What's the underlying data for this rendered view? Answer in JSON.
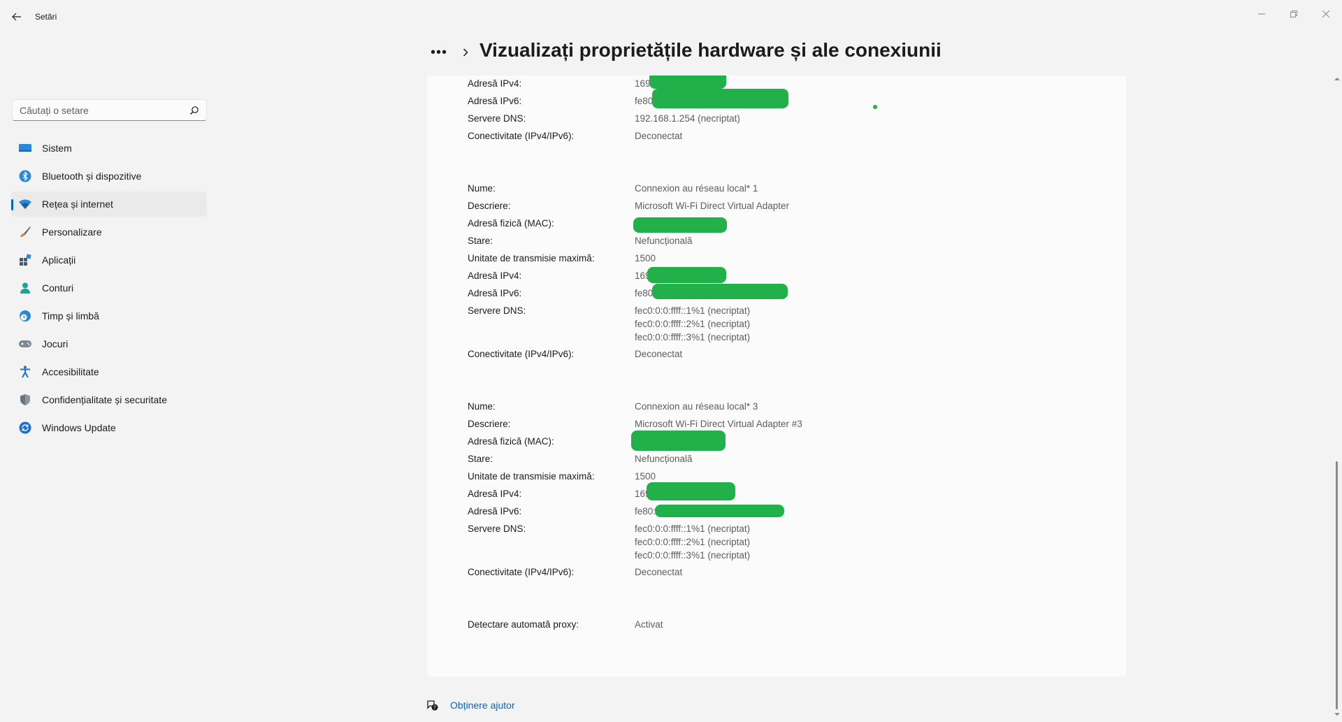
{
  "window": {
    "app_title": "Setări"
  },
  "search": {
    "placeholder": "Căutați o setare"
  },
  "sidebar": {
    "items": [
      {
        "label": "Sistem",
        "icon": "system-icon"
      },
      {
        "label": "Bluetooth și dispozitive",
        "icon": "bluetooth-icon"
      },
      {
        "label": "Rețea și internet",
        "icon": "wifi-icon",
        "active": true
      },
      {
        "label": "Personalizare",
        "icon": "brush-icon"
      },
      {
        "label": "Aplicații",
        "icon": "apps-icon"
      },
      {
        "label": "Conturi",
        "icon": "account-icon"
      },
      {
        "label": "Timp și limbă",
        "icon": "globe-clock-icon"
      },
      {
        "label": "Jocuri",
        "icon": "gamepad-icon"
      },
      {
        "label": "Accesibilitate",
        "icon": "accessibility-icon"
      },
      {
        "label": "Confidențialitate și securitate",
        "icon": "shield-icon"
      },
      {
        "label": "Windows Update",
        "icon": "update-icon"
      }
    ]
  },
  "header": {
    "more": "•••",
    "title": "Vizualizați proprietățile hardware și ale conexiunii"
  },
  "top_block": {
    "ipv4_label": "Adresă IPv4:",
    "ipv4_value": "169",
    "ipv6_label": "Adresă IPv6:",
    "ipv6_value": "fe80",
    "dns_label": "Servere DNS:",
    "dns_value": "192.168.1.254 (necriptat)",
    "conn_label": "Conectivitate (IPv4/IPv6):",
    "conn_value": "Deconectat"
  },
  "adapter1": {
    "name_label": "Nume:",
    "name_value": "Connexion au réseau local* 1",
    "desc_label": "Descriere:",
    "desc_value": "Microsoft Wi-Fi Direct Virtual Adapter",
    "mac_label": "Adresă fizică (MAC):",
    "state_label": "Stare:",
    "state_value": "Nefuncțională",
    "mtu_label": "Unitate de transmisie maximă:",
    "mtu_value": "1500",
    "ipv4_label": "Adresă IPv4:",
    "ipv4_value": "169",
    "ipv6_label": "Adresă IPv6:",
    "ipv6_value": "fe80",
    "dns_label": "Servere DNS:",
    "dns_values": [
      "fec0:0:0:ffff::1%1 (necriptat)",
      "fec0:0:0:ffff::2%1 (necriptat)",
      "fec0:0:0:ffff::3%1 (necriptat)"
    ],
    "conn_label": "Conectivitate (IPv4/IPv6):",
    "conn_value": "Deconectat"
  },
  "adapter3": {
    "name_label": "Nume:",
    "name_value": "Connexion au réseau local* 3",
    "desc_label": "Descriere:",
    "desc_value": "Microsoft Wi-Fi Direct Virtual Adapter #3",
    "mac_label": "Adresă fizică (MAC):",
    "state_label": "Stare:",
    "state_value": "Nefuncțională",
    "mtu_label": "Unitate de transmisie maximă:",
    "mtu_value": "1500",
    "ipv4_label": "Adresă IPv4:",
    "ipv4_value": "169",
    "ipv6_label": "Adresă IPv6:",
    "ipv6_value": "fe80:",
    "dns_label": "Servere DNS:",
    "dns_values": [
      "fec0:0:0:ffff::1%1 (necriptat)",
      "fec0:0:0:ffff::2%1 (necriptat)",
      "fec0:0:0:ffff::3%1 (necriptat)"
    ],
    "conn_label": "Conectivitate (IPv4/IPv6):",
    "conn_value": "Deconectat"
  },
  "proxy": {
    "label": "Detectare automată proxy:",
    "value": "Activat"
  },
  "help": {
    "link": "Obținere ajutor"
  },
  "colors": {
    "accent": "#0067c0",
    "redaction": "#22b04b",
    "background": "#f3f3f3",
    "card": "#fbfbfb"
  }
}
